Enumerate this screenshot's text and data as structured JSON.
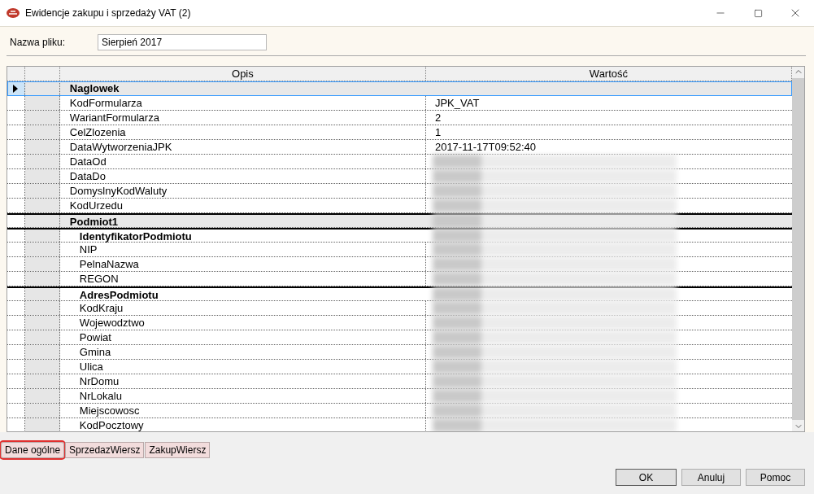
{
  "window": {
    "title": "Ewidencje zakupu i sprzedaży VAT (2)"
  },
  "file_name": {
    "label": "Nazwa pliku:",
    "value": "Sierpień 2017"
  },
  "grid": {
    "columns": [
      "Opis",
      "Wartość"
    ],
    "tree": [
      {
        "kind": "group",
        "label": "Naglowek",
        "selected": true,
        "children": [
          {
            "kind": "field",
            "label": "KodFormularza",
            "value": "JPK_VAT",
            "selected": false
          },
          {
            "kind": "field",
            "label": "WariantFormularza",
            "value": "2",
            "selected": false
          },
          {
            "kind": "field",
            "label": "CelZlozenia",
            "value": "1",
            "selected": false
          },
          {
            "kind": "field",
            "label": "DataWytworzeniaJPK",
            "value": "2017-11-17T09:52:40",
            "selected": false
          },
          {
            "kind": "field",
            "label": "DataOd",
            "selected": false,
            "blurred": true
          },
          {
            "kind": "field",
            "label": "DataDo",
            "selected": false,
            "blurred": true
          },
          {
            "kind": "field",
            "label": "DomyslnyKodWaluty",
            "selected": false,
            "blurred": true
          },
          {
            "kind": "field",
            "label": "KodUrzedu",
            "selected": false,
            "blurred": true
          }
        ]
      },
      {
        "kind": "group",
        "label": "Podmiot1",
        "selected": false,
        "blurred": true,
        "children": [
          {
            "kind": "group",
            "label": "IdentyfikatorPodmiotu",
            "selected": false,
            "blurred": true,
            "children": [
              {
                "kind": "field",
                "label": "NIP",
                "selected": false,
                "blurred": true
              },
              {
                "kind": "field",
                "label": "PelnaNazwa",
                "selected": false,
                "blurred": true
              },
              {
                "kind": "field",
                "label": "REGON",
                "selected": false,
                "blurred": true
              }
            ]
          },
          {
            "kind": "group",
            "label": "AdresPodmiotu",
            "selected": false,
            "blurred": true,
            "children": [
              {
                "kind": "field",
                "label": "KodKraju",
                "selected": false,
                "blurred": true
              },
              {
                "kind": "field",
                "label": "Wojewodztwo",
                "selected": false,
                "blurred": true
              },
              {
                "kind": "field",
                "label": "Powiat",
                "selected": false,
                "blurred": true
              },
              {
                "kind": "field",
                "label": "Gmina",
                "selected": false,
                "blurred": true
              },
              {
                "kind": "field",
                "label": "Ulica",
                "selected": false,
                "blurred": true
              },
              {
                "kind": "field",
                "label": "NrDomu",
                "selected": false,
                "blurred": true
              },
              {
                "kind": "field",
                "label": "NrLokalu",
                "selected": false,
                "blurred": true
              },
              {
                "kind": "field",
                "label": "Miejscowosc",
                "selected": false,
                "blurred": true
              },
              {
                "kind": "field",
                "label": "KodPocztowy",
                "selected": false,
                "blurred": true
              }
            ]
          }
        ]
      }
    ]
  },
  "tabs": [
    {
      "label": "Dane ogólne",
      "selected": true
    },
    {
      "label": "SprzedazWiersz",
      "selected": false
    },
    {
      "label": "ZakupWiersz",
      "selected": false
    }
  ],
  "buttons": [
    {
      "label": "OK",
      "default": true
    },
    {
      "label": "Anuluj",
      "default": false
    },
    {
      "label": "Pomoc",
      "default": false
    }
  ]
}
